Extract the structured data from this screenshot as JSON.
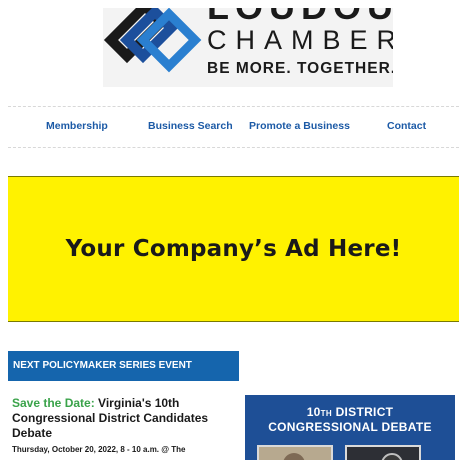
{
  "logo": {
    "line1": "LOUDOUN",
    "line2": "CHAMBER",
    "tagline": "BE MORE. TOGETHER.",
    "colors": {
      "dark": "#1a1a1a",
      "blue": "#1c4f9c",
      "light_blue": "#2a7fd0"
    }
  },
  "nav": {
    "items": [
      {
        "label": "Membership"
      },
      {
        "label": "Business Search"
      },
      {
        "label": "Promote a Business"
      },
      {
        "label": "Contact"
      }
    ],
    "link_color": "#1c5aa6"
  },
  "ad": {
    "text": "Your Company’s Ad Here!",
    "background": "#fff200"
  },
  "section": {
    "header": "NEXT POLICYMAKER SERIES EVENT",
    "header_bg": "#1565ad"
  },
  "article": {
    "lead": "Save the Date:",
    "title": "Virginia's 10th Congressional District Candidates Debate",
    "meta": "Thursday, October 20, 2022, 8 - 10 a.m. @ The"
  },
  "debate_image": {
    "line1_num": "10",
    "line1_sup": "TH",
    "line1_rest": "DISTRICT",
    "line2": "CONGRESSIONAL DEBATE",
    "background": "#1e4f96"
  }
}
